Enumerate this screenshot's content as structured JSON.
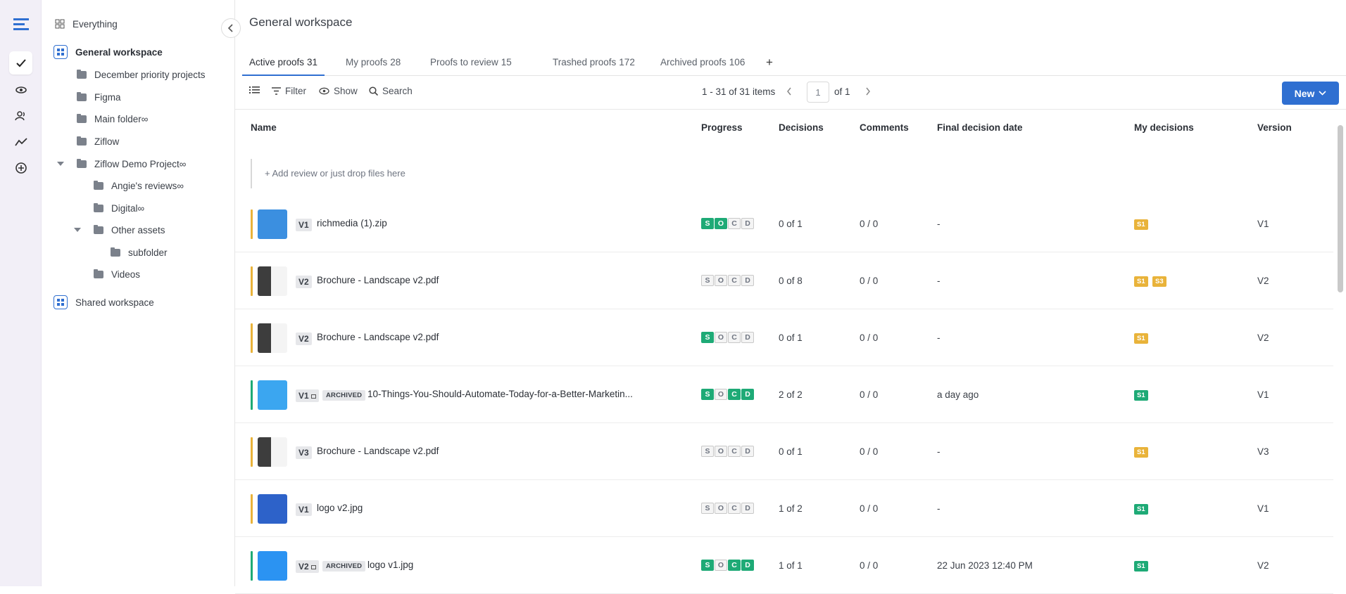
{
  "nav_rail": {
    "items": [
      {
        "icon": "menu-logo-icon"
      },
      {
        "icon": "checkmark-icon",
        "active": true
      },
      {
        "icon": "eye-icon"
      },
      {
        "icon": "users-icon"
      },
      {
        "icon": "activity-icon"
      },
      {
        "icon": "plus-circle-icon"
      }
    ]
  },
  "sidebar": {
    "everything": "Everything",
    "general_workspace": "General workspace",
    "folders": [
      "December priority projects",
      "Figma",
      "Main folder∞",
      "Ziflow",
      "Ziflow Demo Project∞",
      "Angie's reviews∞",
      "Digital∞",
      "Other assets",
      "subfolder",
      "Videos"
    ],
    "shared_workspace": "Shared workspace"
  },
  "header": {
    "title": "General workspace"
  },
  "tabs": [
    {
      "label": "Active proofs",
      "count": "31"
    },
    {
      "label": "My proofs",
      "count": "28"
    },
    {
      "label": "Proofs to review",
      "count": "15"
    },
    {
      "label": "Trashed proofs",
      "count": "172"
    },
    {
      "label": "Archived proofs",
      "count": "106"
    }
  ],
  "toolbar": {
    "filter": "Filter",
    "show": "Show",
    "search": "Search",
    "range": "1 - 31 of 31 items",
    "page": "1",
    "of": "of 1",
    "new": "New"
  },
  "columns": {
    "name": "Name",
    "progress": "Progress",
    "decisions": "Decisions",
    "comments": "Comments",
    "final_date": "Final decision date",
    "my_decisions": "My decisions",
    "version": "Version"
  },
  "add_row": "+ Add review or just drop files here",
  "colors": {
    "accent": "#2f6fd1",
    "green": "#1eaa76",
    "yellow": "#e9b33a"
  },
  "rows": [
    {
      "v": "V1",
      "name": "richmedia (1).zip",
      "socd": "S O",
      "decisions": "0 of 1",
      "comments": "0 / 0",
      "final": "-",
      "my": [
        "S1"
      ],
      "version": "V1"
    },
    {
      "v": "V2",
      "name": "Brochure - Landscape v2.pdf",
      "socd": "",
      "decisions": "0 of 8",
      "comments": "0 / 0",
      "final": "-",
      "my": [
        "S1",
        "S3"
      ],
      "version": "V2"
    },
    {
      "v": "V2",
      "name": "Brochure - Landscape v2.pdf",
      "socd": "S",
      "decisions": "0 of 1",
      "comments": "0 / 0",
      "final": "-",
      "my": [
        "S1"
      ],
      "version": "V2"
    },
    {
      "v": "V1",
      "archived": "ARCHIVED",
      "name": "10-Things-You-Should-Automate-Today-for-a-Better-Marketin...",
      "socd": "S C D",
      "decisions": "2 of 2",
      "comments": "0 / 0",
      "final": "a day ago",
      "my": [
        "S1"
      ],
      "version": "V1"
    },
    {
      "v": "V3",
      "name": "Brochure - Landscape v2.pdf",
      "socd": "",
      "decisions": "0 of 1",
      "comments": "0 / 0",
      "final": "-",
      "my": [
        "S1"
      ],
      "version": "V3"
    },
    {
      "v": "V1",
      "name": "logo v2.jpg",
      "socd": "",
      "decisions": "1 of 2",
      "comments": "0 / 0",
      "final": "-",
      "my": [
        "S1"
      ],
      "version": "V1"
    },
    {
      "v": "V2",
      "archived": "ARCHIVED",
      "name": "logo v1.jpg",
      "socd": "S C D",
      "decisions": "1 of 1",
      "comments": "0 / 0",
      "final": "22 Jun 2023 12:40 PM",
      "my": [
        "S1"
      ],
      "version": "V2"
    }
  ],
  "socd_letters": [
    "S",
    "O",
    "C",
    "D"
  ]
}
